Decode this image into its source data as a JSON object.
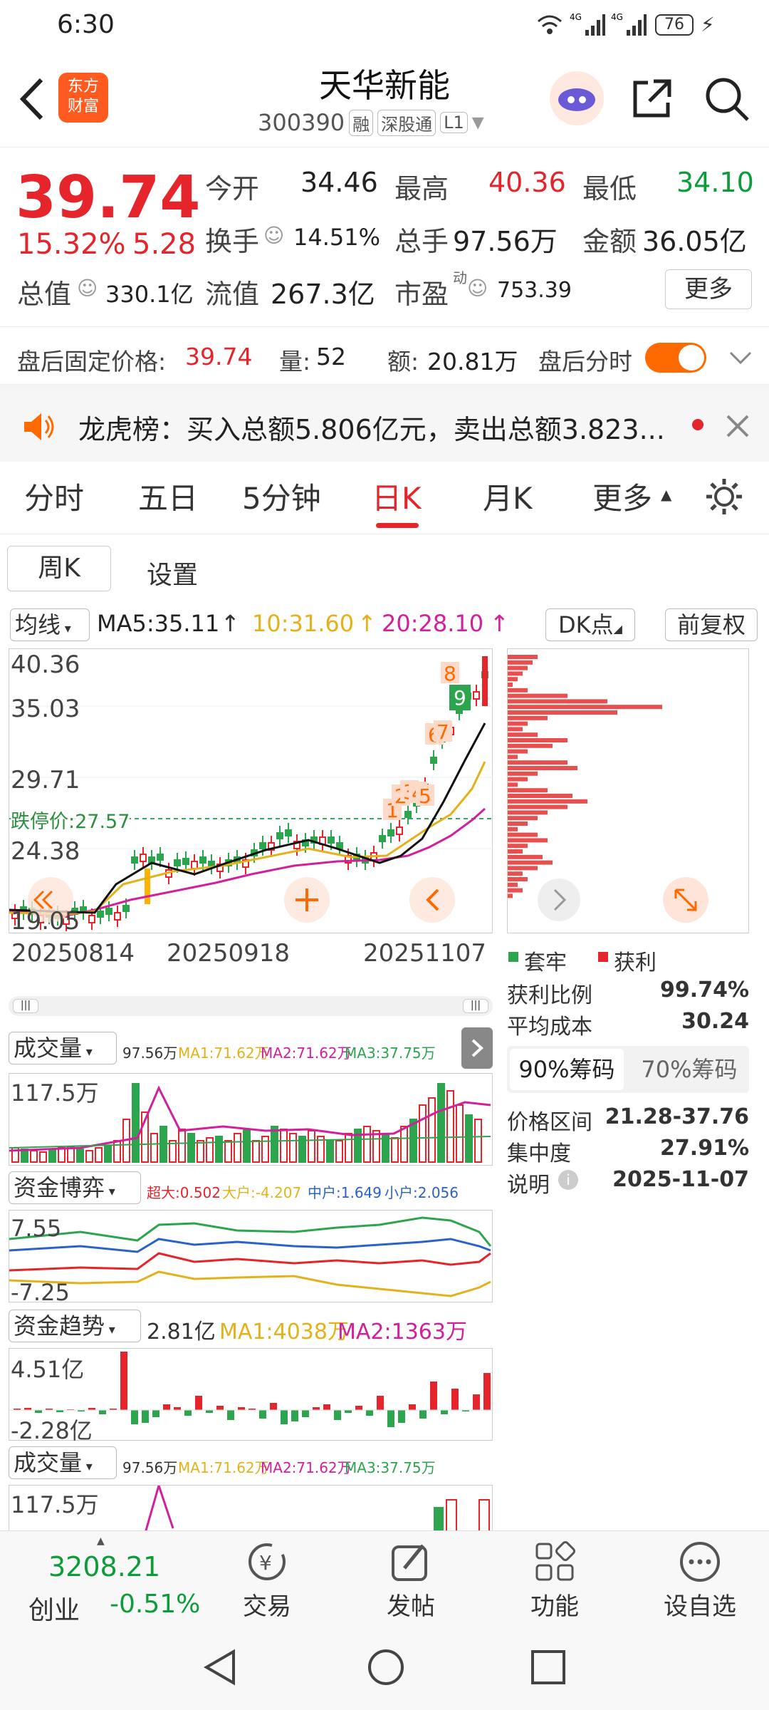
{
  "status": {
    "time": "6:30",
    "battery": "76"
  },
  "header": {
    "title": "天华新能",
    "code": "300390",
    "tags": [
      "融",
      "深股通",
      "L1"
    ],
    "logo_text": "东方\n财富"
  },
  "quote": {
    "price": "39.74",
    "pct": "15.32%",
    "chg": "5.28",
    "open_l": "今开",
    "open": "34.46",
    "high_l": "最高",
    "high": "40.36",
    "low_l": "最低",
    "low": "34.10",
    "turn_l": "换手",
    "turn": "14.51%",
    "vol_l": "总手",
    "vol": "97.56万",
    "amt_l": "金额",
    "amt": "36.05亿",
    "mcap_l": "总值",
    "mcap": "330.1亿",
    "float_l": "流值",
    "float": "267.3亿",
    "pe_l": "市盈",
    "pe_sup": "动",
    "pe": "753.39",
    "more": "更多"
  },
  "after": {
    "label": "盘后固定价格:",
    "price": "39.74",
    "vol_l": "量:",
    "vol": "52",
    "amt_l": "额:",
    "amt": "20.81万",
    "toggle": "盘后分时"
  },
  "notice": {
    "text": "龙虎榜：买入总额5.806亿元，卖出总额3.823..."
  },
  "tabs": [
    "分时",
    "五日",
    "5分钟",
    "日K",
    "月K",
    "更多"
  ],
  "subtabs": [
    "周K",
    "设置"
  ],
  "ma": {
    "sel": "均线",
    "ma5": "MA5:35.11",
    "ma10": "10:31.60",
    "ma20": "20:28.10",
    "dk": "DK点",
    "fq": "前复权"
  },
  "kchart": {
    "y_labels": [
      "40.36",
      "35.03",
      "29.71",
      "24.38",
      "19.05"
    ],
    "limit": "跌停价:27.57",
    "dates": [
      "20250814",
      "20250918",
      "20251107"
    ]
  },
  "chip": {
    "legend": [
      "套牢",
      "获利"
    ],
    "profit_l": "获利比例",
    "profit": "99.74%",
    "avg_l": "平均成本",
    "avg": "30.24",
    "tab90": "90%筹码",
    "tab70": "70%筹码",
    "range_l": "价格区间",
    "range": "21.28-37.76",
    "conc_l": "集中度",
    "conc": "27.91%",
    "note_l": "说明",
    "note": "2025-11-07"
  },
  "vol": {
    "sel": "成交量",
    "v": "97.56万",
    "ma1": "MA1:71.62万",
    "ma2": "MA2:71.62万",
    "ma3": "MA3:37.75万",
    "top": "117.5万"
  },
  "fund": {
    "sel": "资金博弈",
    "a": "超大:0.502",
    "b": "大户:-4.207",
    "c": "中户:1.649",
    "d": "小户:2.056",
    "top": "7.55",
    "bot": "-7.25"
  },
  "trend": {
    "sel": "资金趋势",
    "v": "2.81亿",
    "ma1": "MA1:4038万",
    "ma2": "MA2:1363万",
    "top": "4.51亿",
    "bot": "-2.28亿"
  },
  "vol2": {
    "sel": "成交量",
    "v": "97.56万",
    "ma1": "MA1:71.62万",
    "ma2": "MA2:71.62万",
    "ma3": "MA3:37.75万",
    "top": "117.5万"
  },
  "bottom": {
    "index": "3208.21",
    "idx_name": "创业",
    "idx_pct": "-0.51%",
    "items": [
      "交易",
      "发帖",
      "功能",
      "设自选"
    ]
  },
  "colors": {
    "red": "#e5242b",
    "green": "#0c9d3a",
    "orange": "#ff6a00"
  }
}
